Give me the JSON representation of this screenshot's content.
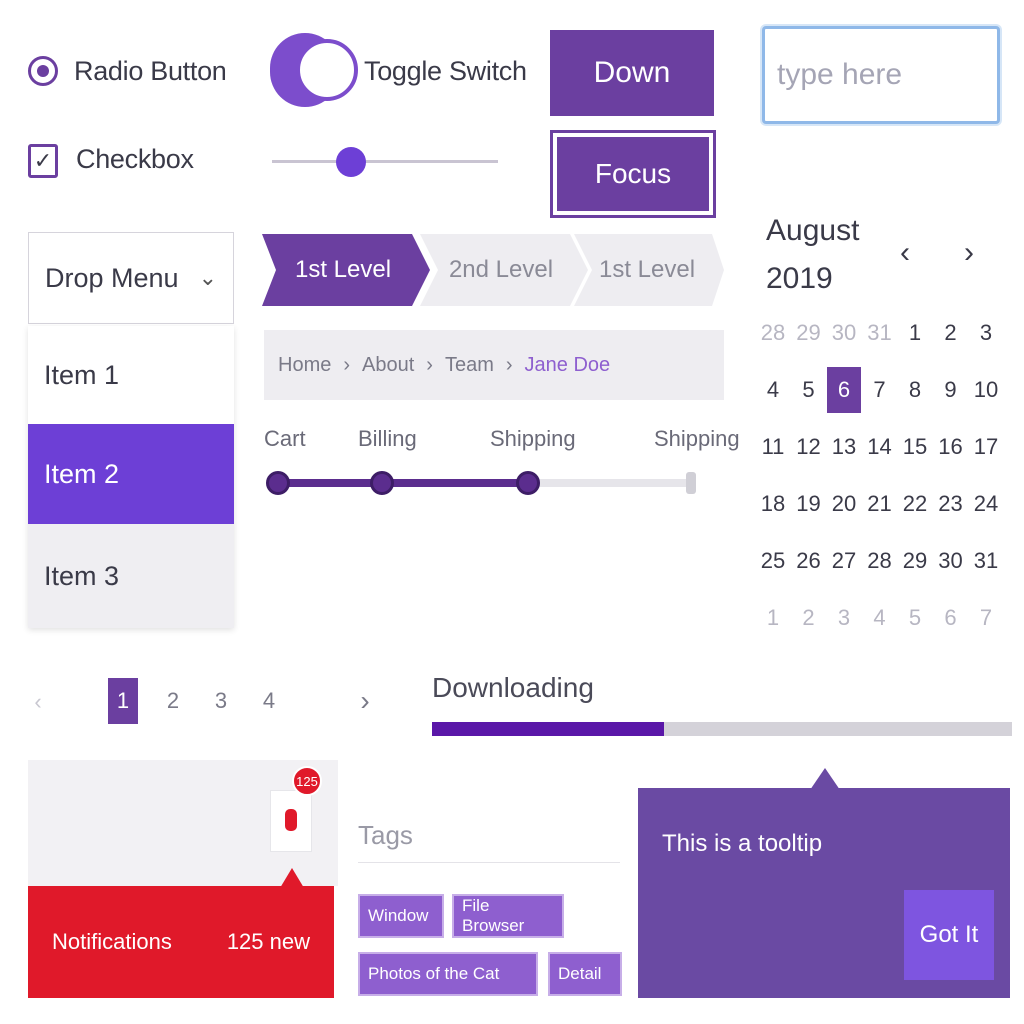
{
  "controls": {
    "radio_label": "Radio Button",
    "checkbox_label": "Checkbox",
    "checkbox_mark": "✓",
    "toggle_label": "Toggle Switch",
    "slider_value_percent": 35
  },
  "buttons": {
    "down_label": "Down",
    "focus_label": "Focus"
  },
  "text_input": {
    "placeholder": "type here"
  },
  "dropdown": {
    "label": "Drop Menu",
    "chevron": "⌄",
    "items": [
      {
        "label": "Item 1",
        "state": "default"
      },
      {
        "label": "Item 2",
        "state": "selected"
      },
      {
        "label": "Item 3",
        "state": "hover"
      }
    ]
  },
  "levels": [
    "1st Level",
    "2nd Level",
    "1st Level"
  ],
  "trail": [
    "Home",
    "About",
    "Team",
    "Jane Doe"
  ],
  "trail_separator": "›",
  "steps": {
    "labels": [
      "Cart",
      "Billing",
      "Shipping",
      "Shipping"
    ],
    "completed": 3
  },
  "calendar": {
    "month": "August",
    "year": "2019",
    "prev": "‹",
    "next": "›",
    "weeks": [
      [
        "28",
        "29",
        "30",
        "31",
        "1",
        "2",
        "3"
      ],
      [
        "4",
        "5",
        "6",
        "7",
        "8",
        "9",
        "10"
      ],
      [
        "11",
        "12",
        "13",
        "14",
        "15",
        "16",
        "17"
      ],
      [
        "18",
        "19",
        "20",
        "21",
        "22",
        "23",
        "24"
      ],
      [
        "25",
        "26",
        "27",
        "28",
        "29",
        "30",
        "31"
      ],
      [
        "1",
        "2",
        "3",
        "4",
        "5",
        "6",
        "7"
      ]
    ],
    "selected_day": "6"
  },
  "pagination": {
    "prev": "‹",
    "pages": [
      "1",
      "2",
      "3",
      "4"
    ],
    "active": "1",
    "next": "›"
  },
  "progress": {
    "label": "Downloading",
    "value_percent": 40
  },
  "notifications": {
    "label": "Notifications",
    "count_text": "125 new",
    "badge": "125"
  },
  "tags": {
    "title": "Tags",
    "items": [
      "Window",
      "File Browser",
      "Photos of the Cat",
      "Detail"
    ]
  },
  "tooltip": {
    "text": "This is a tooltip",
    "button_label": "Got It"
  },
  "colors": {
    "primary": "#6b3fa0",
    "accent": "#7c4dcc",
    "danger": "#e0192a",
    "input_focus": "#8fb8e8"
  }
}
